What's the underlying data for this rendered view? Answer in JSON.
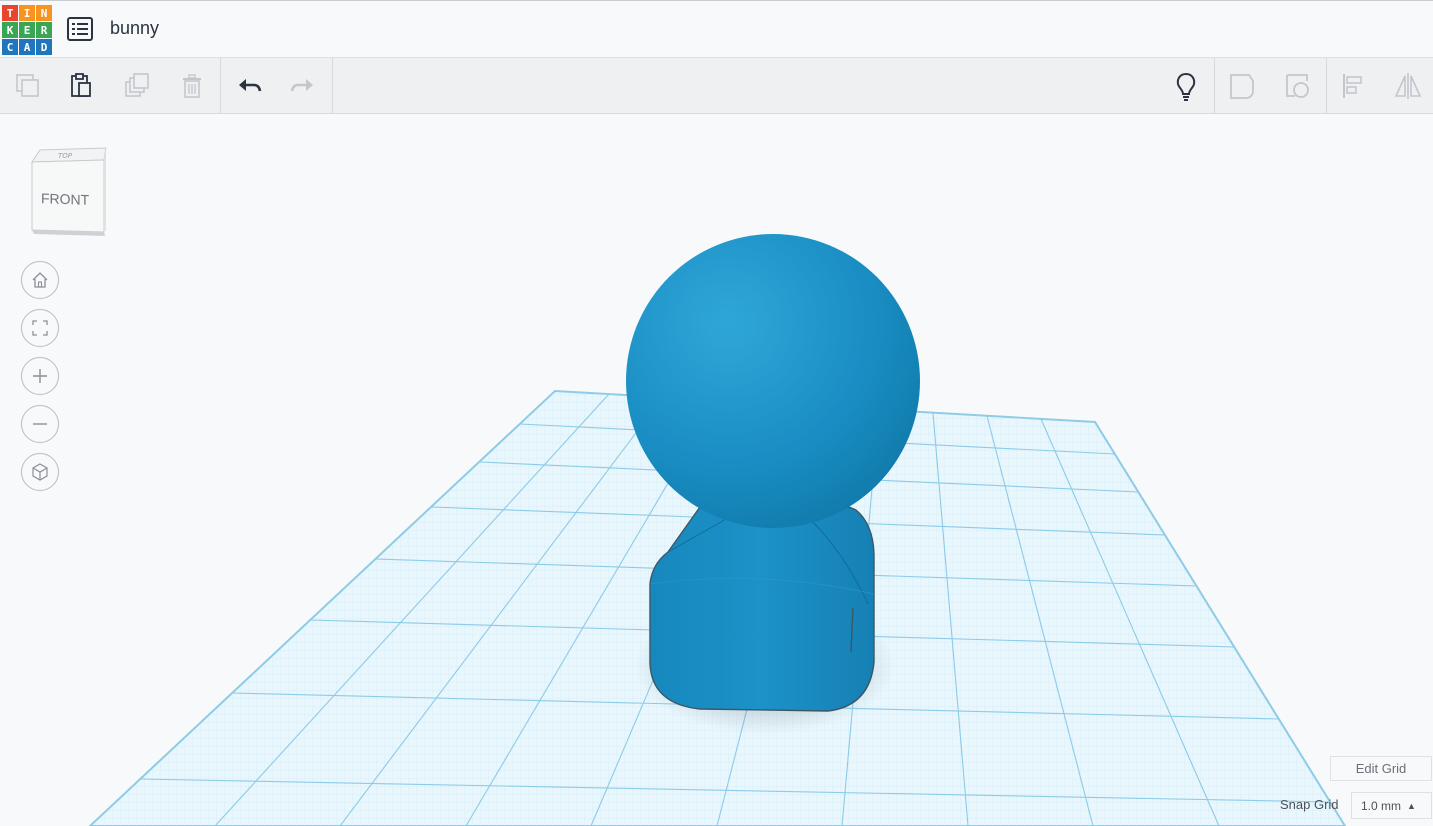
{
  "app": {
    "logo_letters": [
      "T",
      "I",
      "N",
      "K",
      "E",
      "R",
      "C",
      "A",
      "D"
    ],
    "logo_colors": [
      "#e8452c",
      "#f7931e",
      "#f7931e",
      "#3aa655",
      "#3aa655",
      "#3aa655",
      "#1f76bd",
      "#1f76bd",
      "#1f76bd"
    ],
    "document_title": "bunny"
  },
  "toolbar": {
    "left_icons": [
      "copy-icon",
      "paste-icon",
      "duplicate-icon",
      "delete-icon",
      "undo-icon",
      "redo-icon"
    ],
    "right_icons": [
      "lightbulb-icon",
      "note-shape-icon",
      "visible-shape-icon",
      "align-icon",
      "mirror-icon"
    ]
  },
  "viewcube": {
    "top_label": "TOP",
    "front_label": "FRONT"
  },
  "nav": [
    "home-view-icon",
    "fit-view-icon",
    "zoom-in-icon",
    "zoom-out-icon",
    "perspective-icon"
  ],
  "grid": {
    "edit_label": "Edit Grid",
    "snap_label": "Snap Grid",
    "snap_value": "1.0 mm"
  },
  "colors": {
    "shape_blue": "#1a8ec4",
    "grid_line": "#9fd3ec",
    "background": "#f8f9fa"
  }
}
